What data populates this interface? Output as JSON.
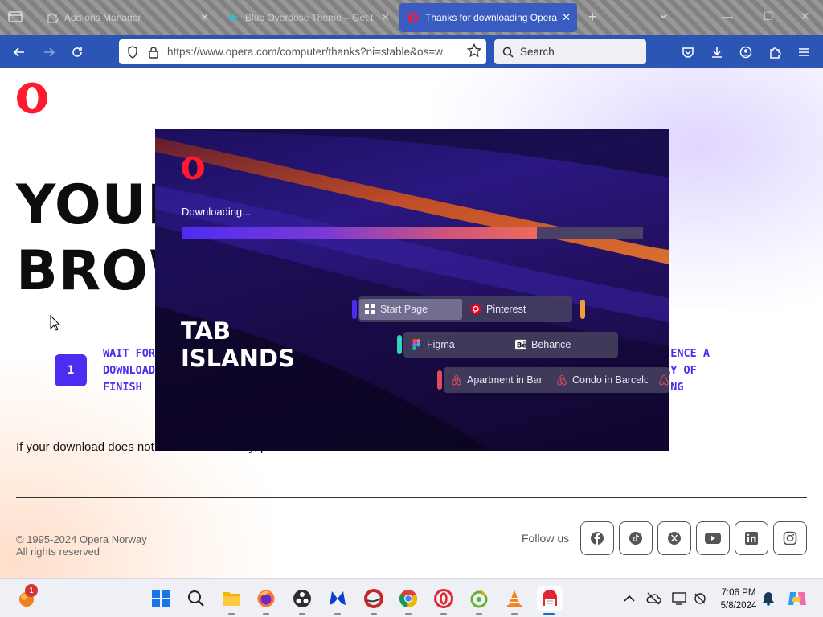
{
  "browser": {
    "tabs": [
      {
        "title": "Add-ons Manager",
        "active": false
      },
      {
        "title": "Blue Overdose Theme – Get t",
        "active": false
      },
      {
        "title": "Thanks for downloading Opera",
        "active": true
      }
    ],
    "new_tab": "+",
    "tab_list": "⌄",
    "close_glyph": "✕",
    "url": "https://www.opera.com/computer/thanks?ni=stable&os=w",
    "search_placeholder": "Search"
  },
  "page": {
    "hero_line1": "YOUR",
    "hero_line2": "BROW",
    "step_number": "1",
    "step_left_text": "WAIT FOR\nDOWNLOAD\nFINISH",
    "step_right_text": "RIENCE A\nWAY OF\nSING",
    "fallback_prefix": "If your download does not start automatically, please ",
    "fallback_link": "click here",
    "fallback_suffix": ".",
    "copyright_line1": "© 1995-2024 Opera Norway",
    "copyright_line2": "All rights reserved",
    "follow_label": "Follow us",
    "social_icons": [
      "facebook-icon",
      "tiktok-icon",
      "x-icon",
      "youtube-icon",
      "linkedin-icon",
      "instagram-icon"
    ],
    "brand_color": "#ff1b2d",
    "accent_color": "#4b2cf0"
  },
  "modal": {
    "status": "Downloading...",
    "progress": 0.77,
    "heading_line1": "TAB",
    "heading_line2": "ISLANDS",
    "islands": [
      {
        "color": "#4b2cf0",
        "tabs": [
          "Start Page",
          "Pinterest"
        ],
        "end_color": "#f0a030"
      },
      {
        "color": "#2fd3c0",
        "tabs": [
          "Figma",
          "Behance"
        ]
      },
      {
        "color": "#e04a5a",
        "tabs": [
          "Apartment in Bar",
          "Condo in Barcelo"
        ]
      }
    ]
  },
  "taskbar": {
    "notification_count": "1",
    "time": "7:06 PM",
    "date": "5/8/2024",
    "apps": [
      "start-icon",
      "search-icon",
      "file-explorer-icon",
      "firefox-icon",
      "obs-icon",
      "malwarebytes-icon",
      "ccleaner-icon",
      "chrome-icon",
      "opera-gx-icon",
      "greenshot-icon",
      "vlc-icon",
      "opera-installer-icon"
    ]
  }
}
